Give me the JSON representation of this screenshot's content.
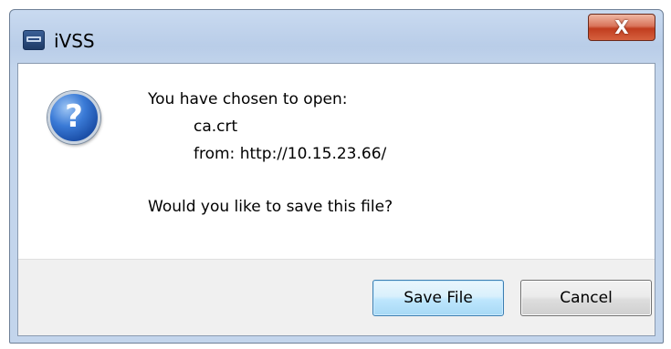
{
  "window": {
    "title": "iVSS",
    "close_glyph": "X",
    "app_icon": "ivss-app-icon"
  },
  "dialog": {
    "icon": "question-icon",
    "icon_glyph": "?",
    "line1": "You have chosen to open:",
    "filename": "ca.crt",
    "source": "from: http://10.15.23.66/",
    "question": "Would you like to save this file?"
  },
  "buttons": {
    "save_label": "Save File",
    "cancel_label": "Cancel"
  },
  "colors": {
    "titlebar": "#b9cde8",
    "close_button": "#c13d1f",
    "footer": "#f0f0f0",
    "default_button_border": "#3c7fb1"
  }
}
